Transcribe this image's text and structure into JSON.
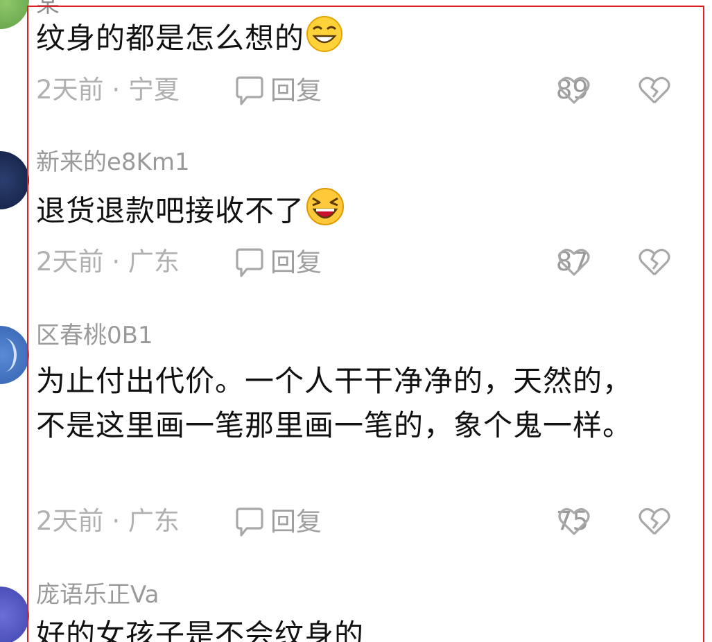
{
  "top_partial_username": "某",
  "comments": [
    {
      "username": "",
      "content": "纹身的都是怎么想的",
      "emoji": "grinning-squint-emoji",
      "time": "2天前",
      "location": "宁夏",
      "reply_label": "回复",
      "likes": "89"
    },
    {
      "username": "新来的e8Km1",
      "content": "退货退款吧接收不了",
      "emoji": "laughing-emoji",
      "time": "2天前",
      "location": "广东",
      "reply_label": "回复",
      "likes": "87"
    },
    {
      "username": "区春桃0B1",
      "content": "为止付出代价。一个人干干净净的，天然的，不是这里画一笔那里画一笔的，象个鬼一样。",
      "emoji": "",
      "time": "2天前",
      "location": "广东",
      "reply_label": "回复",
      "likes": "75"
    },
    {
      "username": "庞语乐正Va",
      "content": "好的女孩子是不会纹身的",
      "emoji": "",
      "time": "",
      "location": "",
      "reply_label": "",
      "likes": ""
    }
  ],
  "meta_separator": "·",
  "colors": {
    "highlight_border": "#e02020",
    "username": "#9a9a9a",
    "content": "#111111",
    "meta": "#b0b0b0"
  }
}
